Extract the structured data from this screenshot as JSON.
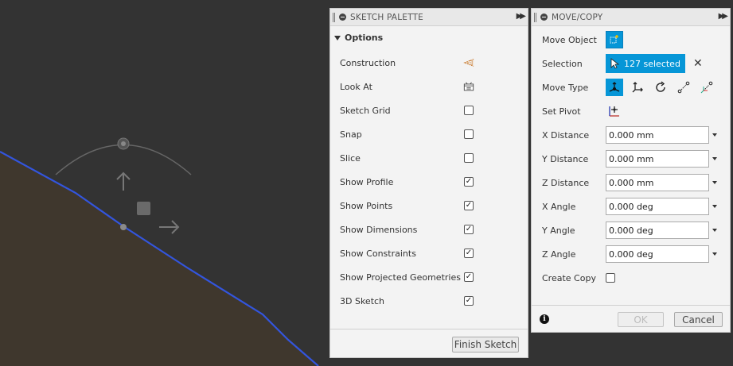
{
  "sketch_palette": {
    "title": "SKETCH PALETTE",
    "section": "Options",
    "options": [
      {
        "label": "Construction",
        "control": "construction-icon"
      },
      {
        "label": "Look At",
        "control": "look-at-icon"
      },
      {
        "label": "Sketch Grid",
        "checked": false
      },
      {
        "label": "Snap",
        "checked": false
      },
      {
        "label": "Slice",
        "checked": false
      },
      {
        "label": "Show Profile",
        "checked": true
      },
      {
        "label": "Show Points",
        "checked": true
      },
      {
        "label": "Show Dimensions",
        "checked": true
      },
      {
        "label": "Show Constraints",
        "checked": true
      },
      {
        "label": "Show Projected Geometries",
        "checked": true
      },
      {
        "label": "3D Sketch",
        "checked": true
      }
    ],
    "finish_label": "Finish Sketch"
  },
  "move_copy": {
    "title": "MOVE/COPY",
    "move_object_label": "Move Object",
    "selection_label": "Selection",
    "selection_value": "127 selected",
    "move_type_label": "Move Type",
    "move_type_icons": [
      "free-move-icon",
      "translate-icon",
      "rotate-icon",
      "point-to-point-icon",
      "point-to-position-icon"
    ],
    "set_pivot_label": "Set Pivot",
    "fields": [
      {
        "label": "X Distance",
        "value": "0.000 mm"
      },
      {
        "label": "Y Distance",
        "value": "0.000 mm"
      },
      {
        "label": "Z Distance",
        "value": "0.000 mm"
      },
      {
        "label": "X Angle",
        "value": "0.000 deg"
      },
      {
        "label": "Y Angle",
        "value": "0.000 deg"
      },
      {
        "label": "Z Angle",
        "value": "0.000 deg"
      }
    ],
    "create_copy_label": "Create Copy",
    "create_copy_checked": false,
    "ok_label": "OK",
    "cancel_label": "Cancel"
  },
  "colors": {
    "viewport_bg": "#333333",
    "profile_fill": "#3f372d",
    "sketch_line": "#3355dd",
    "accent": "#0696d7"
  }
}
